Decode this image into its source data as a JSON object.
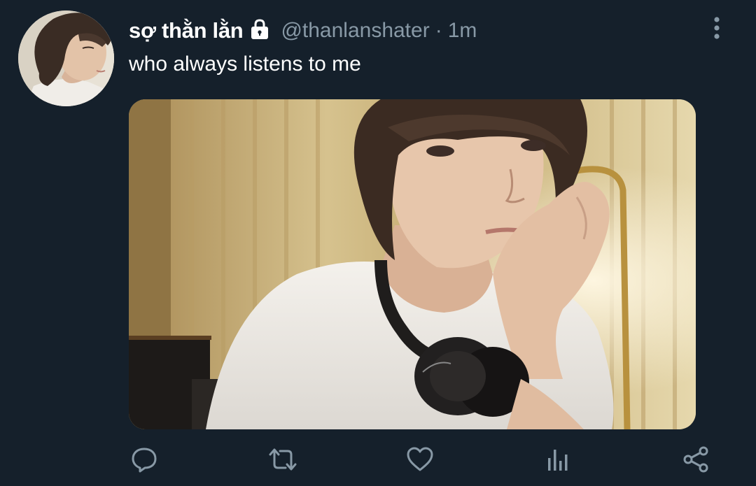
{
  "user": {
    "display_name": "sợ thằn lằn",
    "handle": "@thanlanshater",
    "separator": "·",
    "time": "1m",
    "protected_icon": "lock-icon"
  },
  "tweet": {
    "text": "who always listens to me"
  },
  "menu": {
    "icon": "more-vertical-icon"
  },
  "actions": [
    {
      "name": "reply",
      "icon": "reply-icon"
    },
    {
      "name": "retweet",
      "icon": "retweet-icon"
    },
    {
      "name": "like",
      "icon": "heart-icon"
    },
    {
      "name": "analytics",
      "icon": "analytics-icon"
    },
    {
      "name": "share",
      "icon": "share-icon"
    }
  ],
  "colors": {
    "background": "#15202b",
    "primary_text": "#ffffff",
    "secondary_text": "#8899a6"
  }
}
